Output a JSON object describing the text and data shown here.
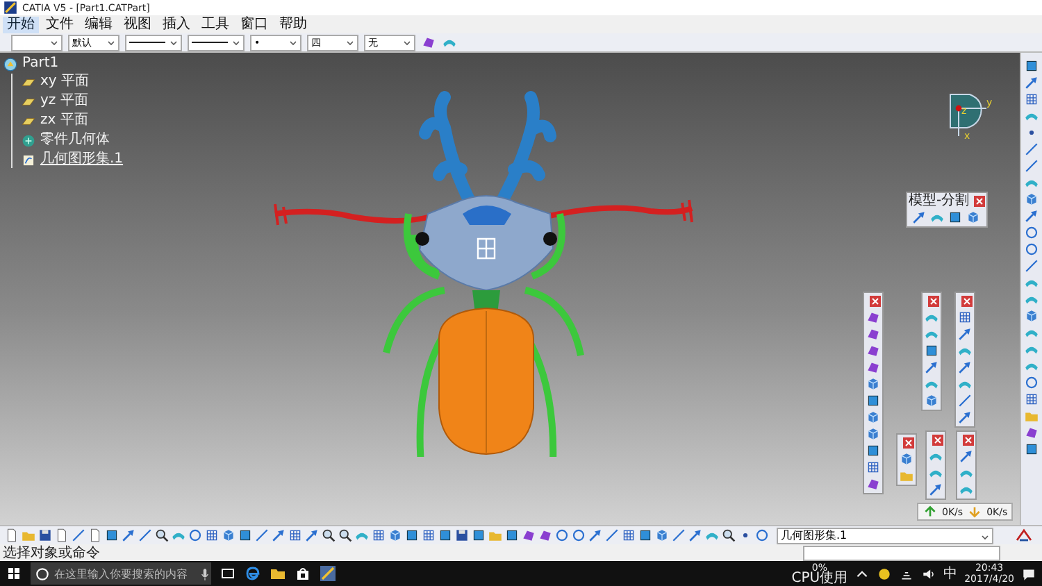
{
  "window": {
    "title": "CATIA V5 - [Part1.CATPart]"
  },
  "menu": [
    {
      "label": "开始",
      "selected": true
    },
    {
      "label": "文件",
      "selected": false
    },
    {
      "label": "编辑",
      "selected": false
    },
    {
      "label": "视图",
      "selected": false
    },
    {
      "label": "插入",
      "selected": false
    },
    {
      "label": "工具",
      "selected": false
    },
    {
      "label": "窗口",
      "selected": false
    },
    {
      "label": "帮助",
      "selected": false
    }
  ],
  "format_toolbar": {
    "combos": [
      {
        "kind": "blank"
      },
      {
        "kind": "text",
        "value": "默认"
      },
      {
        "kind": "line"
      },
      {
        "kind": "line"
      },
      {
        "kind": "text",
        "value": "•"
      },
      {
        "kind": "text",
        "value": "四"
      },
      {
        "kind": "text",
        "value": "无"
      }
    ]
  },
  "tree": {
    "label": "Part1",
    "active": false,
    "children": [
      {
        "label": "xy 平面",
        "kind": "plane",
        "active": false
      },
      {
        "label": "yz 平面",
        "kind": "plane",
        "active": false
      },
      {
        "label": "zx 平面",
        "kind": "plane",
        "active": false
      },
      {
        "label": "零件几何体",
        "kind": "body",
        "active": false
      },
      {
        "label": "几何图形集.1",
        "kind": "set",
        "active": true
      }
    ]
  },
  "compass": {
    "labels": [
      "z",
      "y",
      "x"
    ]
  },
  "floating_toolbar": {
    "title": "模型-分割"
  },
  "network_widget": {
    "upload": "0K/s",
    "download": "0K/s"
  },
  "bottom_toolbar": {
    "combo": "几何图形集.1"
  },
  "status_bar": {
    "prompt": "选择对象或命令"
  },
  "taskbar": {
    "placeholder": "在这里输入你要搜索的内容",
    "cpu_value": "0%",
    "cpu_label": "CPU使用",
    "ime": "中",
    "time": "20:43",
    "date": "2017/4/20"
  }
}
